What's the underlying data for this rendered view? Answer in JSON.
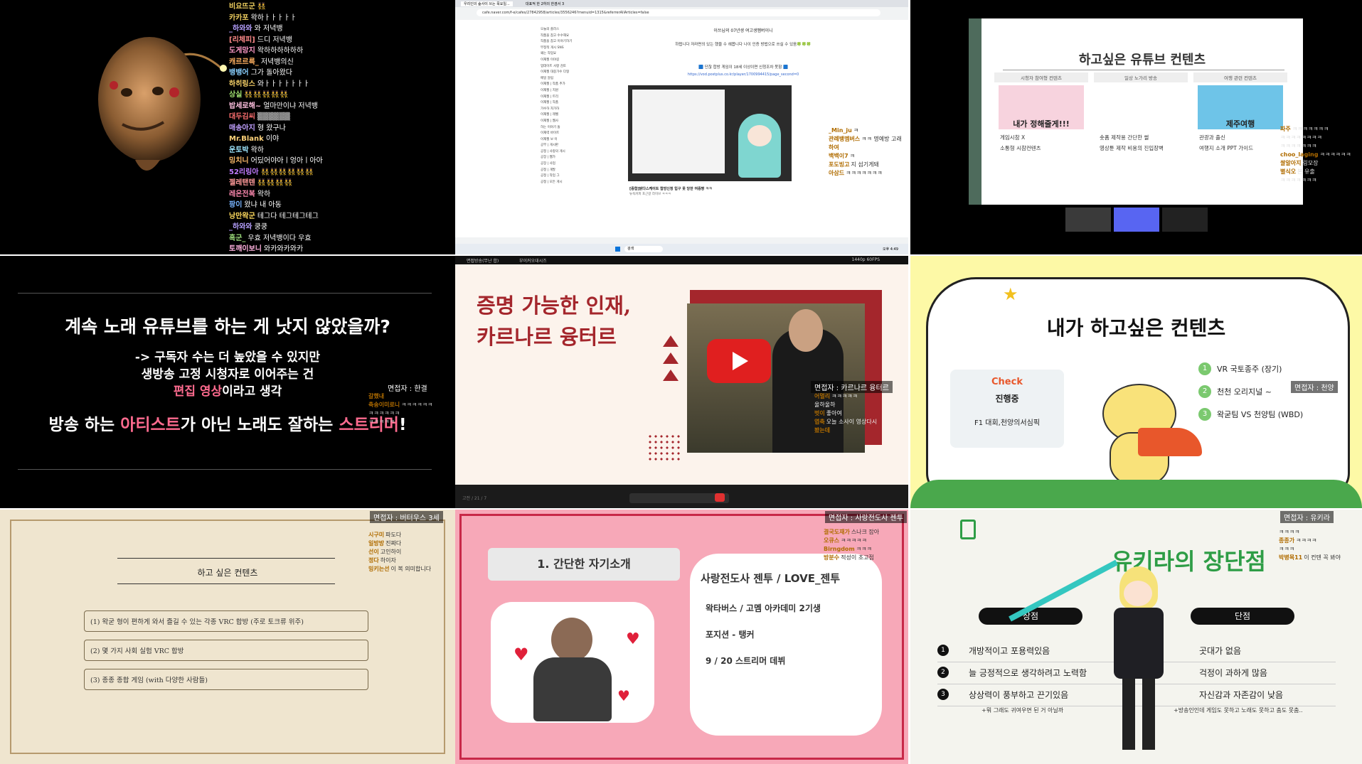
{
  "panel1": {
    "chat": [
      {
        "name": "비요뜨군",
        "msg": "👯",
        "color": "#f0d060"
      },
      {
        "name": "카카포",
        "msg": "왁하ㅏㅏㅏㅏㅏ",
        "color": "#f0d060"
      },
      {
        "name": "_하와와",
        "msg": "와 저녁뱅",
        "color": "#b6a0ff"
      },
      {
        "name": "[리체피]",
        "msg": "드디 저녁뱅",
        "color": "#ff8a8a"
      },
      {
        "name": "도게망지",
        "msg": "왁하하하하하하",
        "color": "#ff9bc8"
      },
      {
        "name": "캐르르륵_",
        "msg": "저녁뱅의신",
        "color": "#ffb060"
      },
      {
        "name": "뱅뱅어",
        "msg": "그가 돌아왔다",
        "color": "#8ad0ff"
      },
      {
        "name": "하히링스",
        "msg": "와ㅏㅏㅏㅏㅏㅏㅏ",
        "color": "#ffd86b"
      },
      {
        "name": "상실",
        "msg": "👯👯👯👯👯",
        "color": "#a0e070"
      },
      {
        "name": "밥세로해~",
        "msg": "얼마만이냐 저녁뱅",
        "color": "#ffc0e0"
      },
      {
        "name": "대두김씨",
        "msg": "▒▒▒▒▒▒",
        "color": "#ff7070"
      },
      {
        "name": "매송아지",
        "msg": "형 왔구나",
        "color": "#c0a0ff"
      },
      {
        "name": "Mr.Blank",
        "msg": "이야",
        "color": "#ffd27a"
      },
      {
        "name": "운토박",
        "msg": "왁하",
        "color": "#9fe7ff"
      },
      {
        "name": "밍치니",
        "msg": "어딨어야아ㅣ엉아ㅣ아아",
        "color": "#ffbd6b"
      },
      {
        "name": "52리링아",
        "msg": "👯👯👯👯👯👯",
        "color": "#c07cff"
      },
      {
        "name": "젤레탠텐",
        "msg": "👯👯👯👯",
        "color": "#ff9a9a"
      },
      {
        "name": "레온전복",
        "msg": "왁하",
        "color": "#ff8ab0"
      },
      {
        "name": "팡이",
        "msg": "왔냐 내 아동",
        "color": "#78b4ff"
      },
      {
        "name": "낭만왁군",
        "msg": "테그다 테그테그테그",
        "color": "#ffdb5e"
      },
      {
        "name": "_하와와",
        "msg": "쿵쿵",
        "color": "#b6a0ff"
      },
      {
        "name": "흑군_",
        "msg": "우효 저녁뱅이다 우효",
        "color": "#a0e07e"
      },
      {
        "name": "토깨이보니",
        "msg": "와카와카와카",
        "color": "#ffb2de"
      }
    ]
  },
  "panel2": {
    "tabs": [
      "우리인의 숲사이 쓰는 목요일...",
      "대표적 한 2하의 한겸서 3"
    ],
    "url": "cafe.naver.com/f-e/cafes/27842958/articles/3556246?menuid=1315&referrerAllArticles=false",
    "article_title": "이쓰님의 07년생 여고생멤버이니",
    "article_lines": [
      "하쩝니다 저라면의 있는 했을 수 헤봅니다 나이 인증 방법으로 쓰실 수 있음🍀🍀🍀"
    ],
    "link_banner": "🟦 단찮 합방 게임이 18세 이상이면 신청조차 못함 🟦",
    "link_url": "https://vod.postplus.co.kr/player/1700994415/page_second=0",
    "video_caption": "[중합]밝다스케이트 합방신청 입구 못 당한 여중짱 ㅋㅋ",
    "video_sub": "뉴욕커피 포근갈 라이브 ㅋㅋㅋ",
    "sidebar_items": [
      "오늘의 플러스",
      "작품을 참고 수수해요",
      "작품을 참고 이야기하기",
      "부정적 게시 SNS",
      "왜는 작업요",
      "이재월 이야길",
      "업데이트 사항 검토",
      "이재월 대중가수 다형",
      "매일 알림",
      "이재월 | 작품 추가",
      "이재월 | 지원",
      "이재월 | 트리",
      "이재월 | 작품",
      "가수하 자가하",
      "이재월 | 레벨",
      "이재월 | 웹사",
      "하는 이야기 돌",
      "이재력 바이트",
      "이재월 보 이",
      "공부 | 게시판",
      "공정 | 사랑의 게시",
      "공장 | 웹가",
      "공장 | 사업",
      "공정 | 개발",
      "공정 | 작업 그",
      "공정 | 모든 게시"
    ],
    "chat_side": [
      {
        "name": "_Min_ju",
        "msg": "ㅋ"
      },
      {
        "name": "관례뱅멤버스",
        "msg": "ㅋㅋ 명예방 고래"
      },
      {
        "name": "하여",
        "msg": ""
      },
      {
        "name": "백백이7",
        "msg": "ㅋ"
      },
      {
        "name": "포도빙고",
        "msg": "지 섬기게돼"
      },
      {
        "name": "아삼드",
        "msg": "ㅋㅋㅋㅋㅋㅋㅋ"
      }
    ],
    "taskbar_search": "검색",
    "taskbar_time": "오후 4:49"
  },
  "panel3": {
    "title": "하고싶은 유튜브 컨텐츠",
    "columns": [
      {
        "header": "시청자 참여형 컨텐츠",
        "thumb_text": "내가 정해줄게!!!",
        "bullets": [
          "게임시참 X",
          "소통형 시참컨텐츠"
        ]
      },
      {
        "header": "일상 노가리 방송",
        "thumb_text": "",
        "bullets": [
          "숏폼 제작용 간단한 썰",
          "영상툰 제작 비용의 진입장벽"
        ]
      },
      {
        "header": "여행 관련 컨텐츠",
        "thumb_text": "제주여행",
        "bullets": [
          "관광과 출신",
          "여행지 소개 PPT 가이드"
        ]
      }
    ],
    "chat": [
      {
        "name": "파주",
        "msg": "ㅋㅋㅋㅋㅋㅋㅋ"
      },
      {
        "name": "",
        "msg": "ㅋㅋㅋㅋㅋㅋㅋㅋ"
      },
      {
        "name": "",
        "msg": "ㅋㅋㅋㅋㅋㅋㅋ"
      },
      {
        "name": "choo_laging",
        "msg": "ㅋㅋㅋㅋㅋㅋ"
      },
      {
        "name": "쌀알아지",
        "msg": "링모장"
      },
      {
        "name": "별식오",
        "msg": "본 유출"
      },
      {
        "name": "",
        "msg": "ㅋㅋㅋㅋㅋㅋㅋ"
      }
    ]
  },
  "panel4": {
    "question": "계속 노래 유튜브를 하는 게 낫지 않았을까?",
    "line1": "-> 구독자 수는 더 높았을 수 있지만",
    "line2": "생방송 고정 시청자로 이어주는 건",
    "line3_highlight": "편집 영상",
    "line3_rest": "이라고 생각",
    "bottom_a": "방송 하는 ",
    "bottom_b": "아티스트",
    "bottom_c": "가 아닌 노래도 잘하는 ",
    "bottom_d": "스트리머",
    "bottom_e": "!",
    "interviewer": "면접자 : 한결",
    "chat": [
      {
        "name": "갈했내",
        "msg": ""
      },
      {
        "name": "축송이미로니",
        "msg": "ㅋㅋㅋㅋㅋㅋ"
      },
      {
        "name": "",
        "msg": "ㅋㅋㅋㅋㅋㅋ"
      },
      {
        "name": "",
        "msg": "ㅋㅋㅋㅋㅋ"
      }
    ]
  },
  "panel5": {
    "title_line1": "증명 가능한 인재,",
    "title_line2": "카르나르 융터르",
    "interviewer": "면접자 : 카르나르 융터르",
    "chat": [
      {
        "name": "어멀리",
        "msg": "ㅋㅋㅋㅋㅋ"
      },
      {
        "name": "",
        "msg": "울하울하"
      },
      {
        "name": "벗이",
        "msg": "좋아여"
      },
      {
        "name": "엽축",
        "msg": "오늘 소사이 영상다시"
      },
      {
        "name": "봤는데",
        "msg": ""
      }
    ],
    "top_tabs": [
      "면접방송(무난 합)",
      "부이커오대시즈"
    ],
    "status": "1440p 60FPS",
    "bottom_caption": "고전 / 21 / 7"
  },
  "panel6": {
    "title": "내가 하고싶은 컨텐츠",
    "check_label": "Check",
    "progress_label": "진행중",
    "progress_item": "F1 대회,천양의서심픽",
    "list": [
      {
        "num": "1",
        "text": "VR 국토종주 (장기)"
      },
      {
        "num": "2",
        "text": "천천 오리지널 ~"
      },
      {
        "num": "3",
        "text": "왁굳팀 VS 천양팀 (WBD)"
      }
    ],
    "interviewer": "면접자 : 천양"
  },
  "panel7": {
    "title": "하고 싶은 컨텐츠",
    "items": [
      "(1) 왁굳 형이 편하게 와서 즐길 수 있는 각종 VRC 합방 (주로 토크류 위주)",
      "(2) 몇 가지 사회 실험 VRC 합방",
      "(3) 종종 종합 게임 (with 다양한 사람들)"
    ],
    "interviewer": "면접자 : 버터우스 3세",
    "chat": [
      {
        "name": "시구미",
        "msg": "파도다"
      },
      {
        "name": "일방방",
        "msg": "진짜다"
      },
      {
        "name": "선이",
        "msg": "고인하이"
      },
      {
        "name": "정다",
        "msg": "하이자"
      },
      {
        "name": "밍키는선",
        "msg": "이 복 의미합니다"
      }
    ]
  },
  "panel8": {
    "section": "1. 간단한 자기소개",
    "name": "사랑전도사 젠투 / LOVE_젠투",
    "bullets": [
      "왁타버스 / 고멤 아카데미 2기생",
      "포지션 - 탱커",
      "9 / 20 스트리머 데뷔"
    ],
    "interviewer": "면접자 : 사랑전도사 젠투",
    "chat": [
      {
        "name": "결국도재가",
        "msg": "스나크 잡아"
      },
      {
        "name": "오큐스",
        "msg": "ㅋㅋㅋㅋㅋ"
      },
      {
        "name": "Birngdom",
        "msg": "ㅋㅋㅋ"
      },
      {
        "name": "방분수",
        "msg": "적성이 초고점"
      }
    ]
  },
  "panel9": {
    "title": "유키라의 장단점",
    "pros_header": "장점",
    "cons_header": "단점",
    "pros": [
      "개방적이고 포용력있음",
      "늘 긍정적으로 생각하려고 노력함",
      "상상력이 풍부하고 끈기있음"
    ],
    "cons": [
      "곳대가 없음",
      "걱정이 과하게 많음",
      "자신감과 자존감이 낮음"
    ],
    "nums": [
      "1",
      "2",
      "3"
    ],
    "pros_foot": "+뭐 그래도 귀여우면 된 거 아닐까",
    "cons_foot": "+방송인인데 게임도 못하고 노래도 못하고 춤도 못춤..",
    "interviewer": "면접자 : 유키라",
    "chat": [
      {
        "name": "",
        "msg": "ㅋㅋㅋㅋ"
      },
      {
        "name": "종종가",
        "msg": "ㅋㅋㅋㅋ"
      },
      {
        "name": "",
        "msg": "ㅋㅋㅋ"
      },
      {
        "name": "박병목11",
        "msg": "이 컨텐 꼭 봐야"
      }
    ]
  },
  "colors": {
    "p4_pink": "#ff6b8f",
    "p5_red": "#a4262c",
    "p6_orange": "#e8572b",
    "p9_green": "#2e9d46"
  }
}
